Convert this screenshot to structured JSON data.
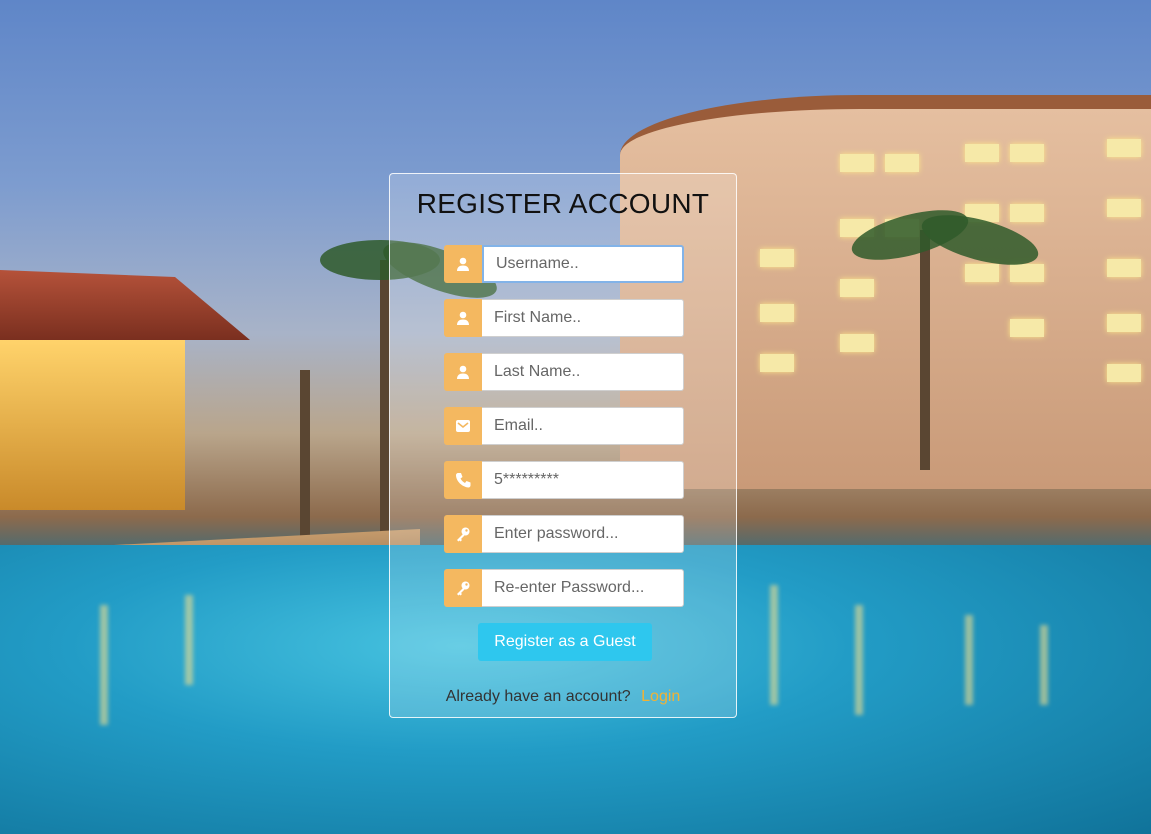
{
  "form": {
    "title": "REGISTER ACCOUNT",
    "fields": [
      {
        "name": "username",
        "placeholder": "Username..",
        "icon": "user-icon",
        "value": ""
      },
      {
        "name": "first_name",
        "placeholder": "First Name..",
        "icon": "user-icon",
        "value": ""
      },
      {
        "name": "last_name",
        "placeholder": "Last Name..",
        "icon": "user-icon",
        "value": ""
      },
      {
        "name": "email",
        "placeholder": "Email..",
        "icon": "envelope-icon",
        "value": ""
      },
      {
        "name": "phone",
        "placeholder": "5*********",
        "icon": "phone-icon",
        "value": ""
      },
      {
        "name": "password",
        "placeholder": "Enter password...",
        "icon": "key-icon",
        "value": ""
      },
      {
        "name": "confirm_password",
        "placeholder": "Re-enter Password...",
        "icon": "key-icon",
        "value": ""
      }
    ],
    "submit_label": "Register as a Guest",
    "footer_text": "Already have an account?",
    "login_link": "Login"
  },
  "colors": {
    "icon_bg": "#f4b860",
    "button_bg": "#2ec7ee",
    "link": "#f2b233"
  }
}
